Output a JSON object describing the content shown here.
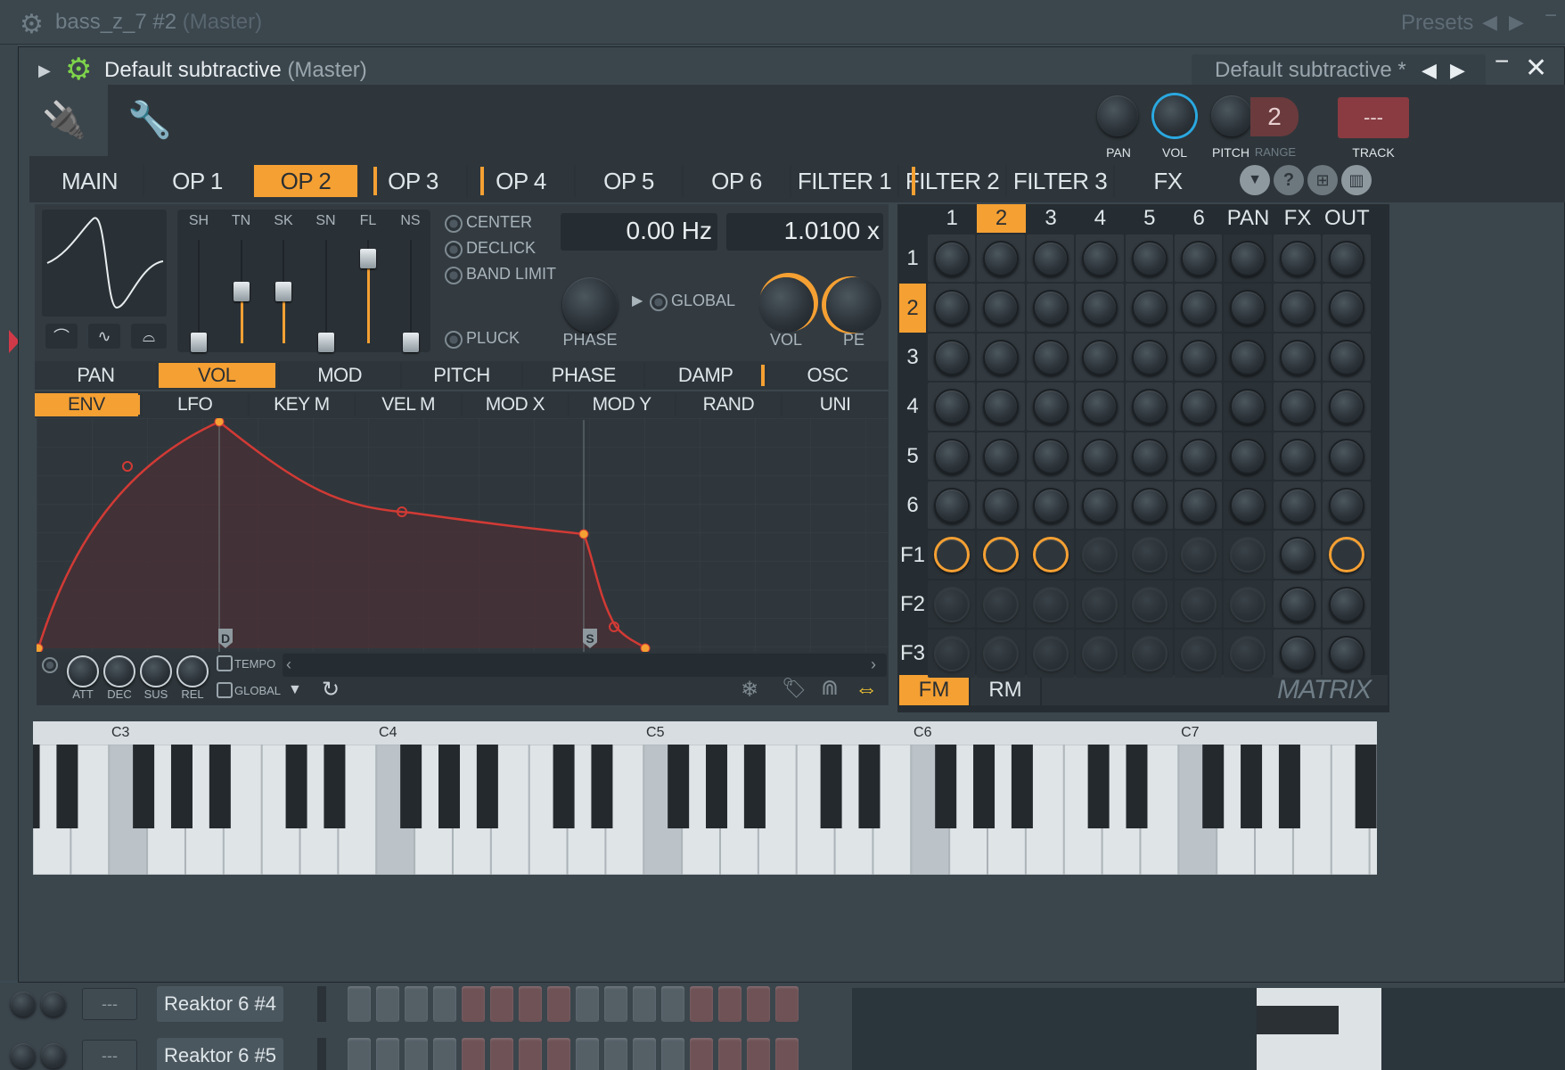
{
  "outer_window": {
    "title": "bass_z_7 #2",
    "title_suffix": "(Master)",
    "presets_label": "Presets"
  },
  "plugin_window": {
    "title": "Default subtractive",
    "title_suffix": "(Master)",
    "preset_name": "Default subtractive *"
  },
  "header": {
    "pan_label": "PAN",
    "vol_label": "VOL",
    "pitch_label": "PITCH",
    "range_label": "RANGE",
    "range_value": "2",
    "track_label": "TRACK",
    "track_value": "---"
  },
  "main_tabs": [
    "MAIN",
    "OP 1",
    "OP 2",
    "OP 3",
    "OP 4",
    "OP 5",
    "OP 6",
    "FILTER 1",
    "FILTER 2",
    "FILTER 3",
    "FX"
  ],
  "selected_main_tab": "OP 2",
  "operator": {
    "slider_labels": [
      "SH",
      "TN",
      "SK",
      "SN",
      "FL",
      "NS"
    ],
    "slider_levels": [
      0.0,
      0.55,
      0.55,
      0.0,
      0.9,
      0.0
    ],
    "options": {
      "center": "CENTER",
      "declick": "DECLICK",
      "band_limit": "BAND LIMIT",
      "pluck": "PLUCK",
      "global": "GLOBAL"
    },
    "freq_value": "0.00 Hz",
    "ratio_value": "1.0100 x",
    "phase_label": "PHASE",
    "vol_label": "VOL",
    "pe_label": "PE"
  },
  "target_tabs": [
    "PAN",
    "VOL",
    "MOD",
    "PITCH",
    "PHASE",
    "DAMP",
    "OSC"
  ],
  "selected_target_tab": "VOL",
  "source_tabs": [
    "ENV",
    "LFO",
    "KEY M",
    "VEL M",
    "MOD X",
    "MOD Y",
    "RAND",
    "UNI"
  ],
  "selected_source_tab": "ENV",
  "envelope": {
    "decay_marker": "D",
    "sustain_marker": "S",
    "knob_labels": [
      "ATT",
      "DEC",
      "SUS",
      "REL"
    ],
    "tempo_label": "TEMPO",
    "global_label": "GLOBAL"
  },
  "matrix": {
    "columns": [
      "1",
      "2",
      "3",
      "4",
      "5",
      "6",
      "PAN",
      "FX",
      "OUT"
    ],
    "rows": [
      "1",
      "2",
      "3",
      "4",
      "5",
      "6",
      "F1",
      "F2",
      "F3"
    ],
    "selected_column": "2",
    "selected_row": "2",
    "fm_label": "FM",
    "rm_label": "RM",
    "logo": "MATRIX"
  },
  "keyboard": {
    "octave_labels": [
      "C3",
      "C4",
      "C5",
      "C6",
      "C7"
    ]
  },
  "channel_rack": {
    "rows": [
      {
        "name": "Reaktor 6 #4",
        "track": "---"
      },
      {
        "name": "Reaktor 6 #5",
        "track": "---"
      }
    ]
  },
  "colors": {
    "accent": "#f5a033",
    "envelope": "#d23a35",
    "background": "#3b454c",
    "panel": "#2a3136"
  }
}
